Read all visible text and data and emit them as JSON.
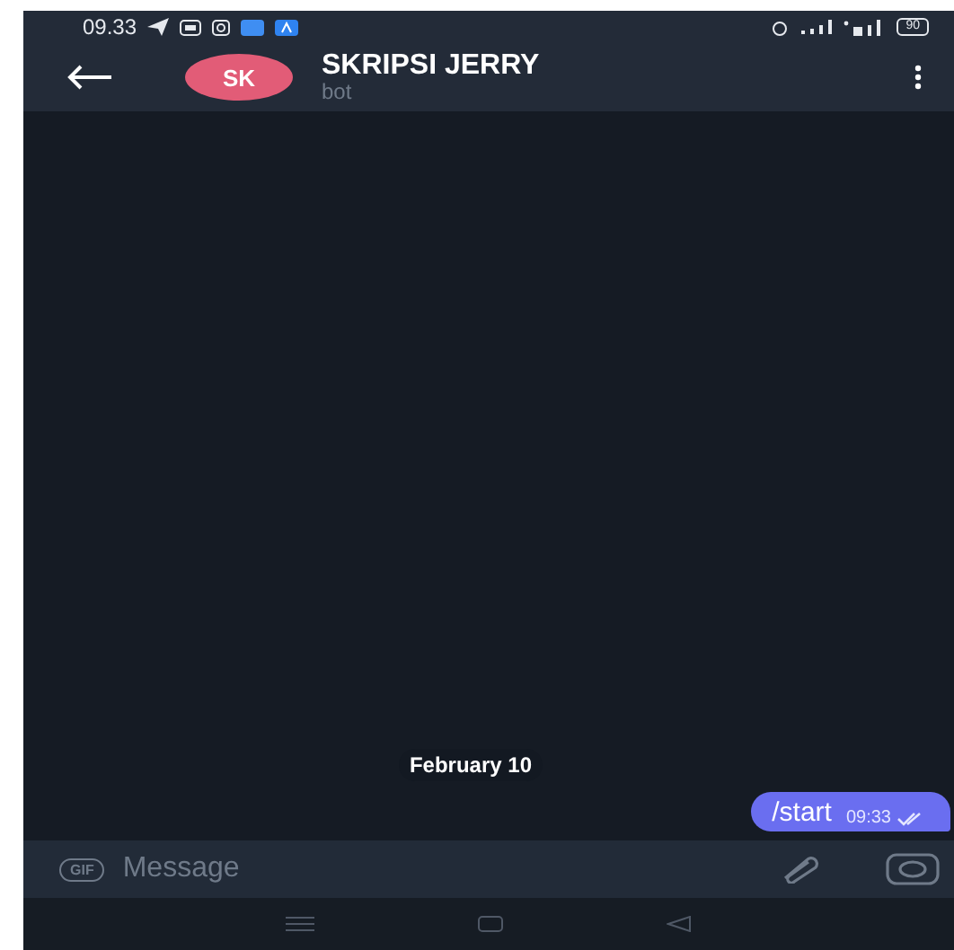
{
  "status_bar": {
    "time": "09.33",
    "battery": "90"
  },
  "header": {
    "initials": "SK",
    "title": "SKRIPSI JERRY",
    "subtitle": "bot"
  },
  "chat": {
    "date": "February 10",
    "messages": [
      {
        "text": "/start",
        "time": "09:33",
        "outgoing": true,
        "read": true
      }
    ]
  },
  "composer": {
    "gif_label": "GIF",
    "placeholder": "Message"
  }
}
